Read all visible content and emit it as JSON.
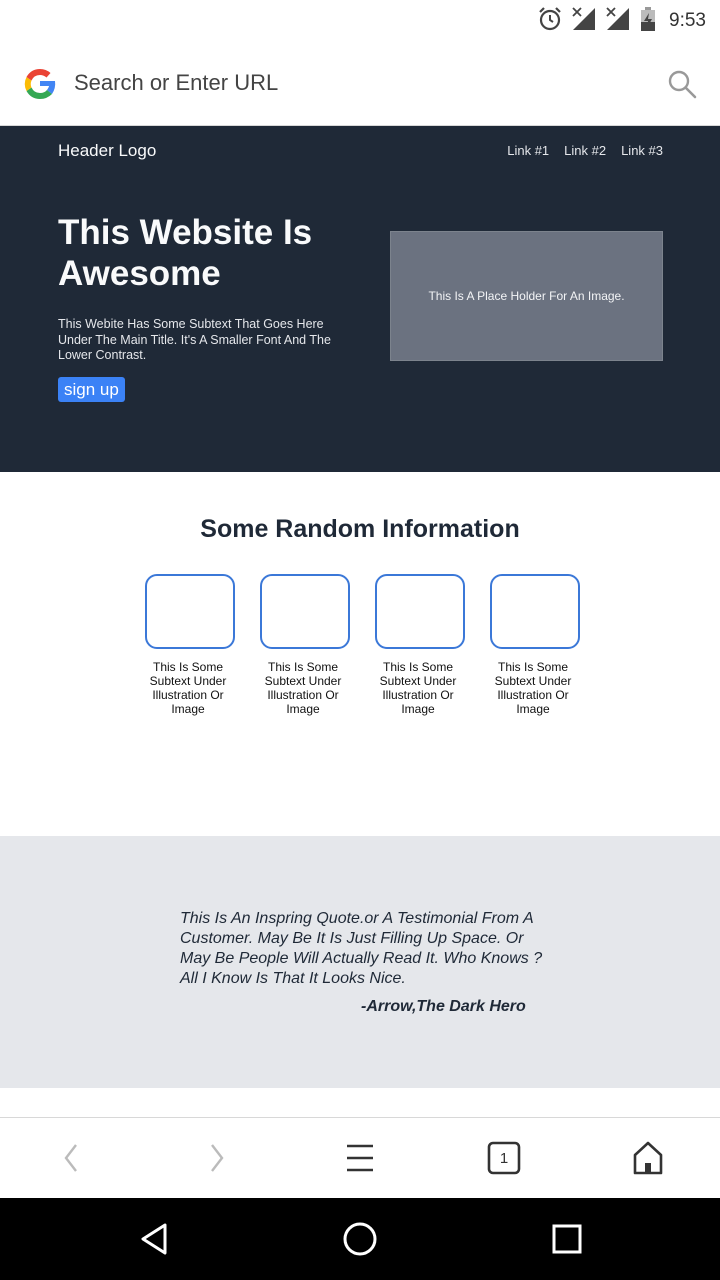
{
  "status_bar": {
    "time": "9:53",
    "icons": [
      "alarm-icon",
      "signal-off-icon",
      "signal-off-icon",
      "battery-charging-icon"
    ]
  },
  "browser": {
    "url_placeholder": "Search or Enter URL",
    "logo": "google-g-logo",
    "search_icon": "search-icon"
  },
  "hero": {
    "logo": "Header Logo",
    "nav": [
      "Link #1",
      "Link #2",
      "Link #3"
    ],
    "title": "This Website Is Awesome",
    "subtitle": "This Webite Has Some Subtext That Goes Here Under The Main Title. It's A Smaller Font And The Lower Contrast.",
    "button": "sign up",
    "image_placeholder": "This Is A Place Holder For An Image."
  },
  "info": {
    "title": "Some Random Information",
    "cards": [
      {
        "text": "This Is Some Subtext Under Illustration Or Image"
      },
      {
        "text": "This Is Some Subtext Under Illustration Or Image"
      },
      {
        "text": "This Is Some Subtext Under Illustration Or Image"
      },
      {
        "text": "This Is Some Subtext Under Illustration Or Image"
      }
    ]
  },
  "quote": {
    "text": "This Is An Inspring Quote.or A Testimonial From A Customer. May Be It Is Just Filling Up Space. Or May Be People Will Actually Read It. Who Knows ? All I Know Is That It Looks Nice.",
    "author": "-Arrow,The Dark Hero"
  },
  "toolbar": {
    "tab_count": "1",
    "items": [
      "back-icon",
      "forward-icon",
      "menu-icon",
      "tabs-icon",
      "home-icon"
    ]
  },
  "android_nav": {
    "items": [
      "back-triangle-icon",
      "home-circle-icon",
      "recents-square-icon"
    ]
  },
  "colors": {
    "hero_bg": "#1f2937",
    "accent": "#3b82f6",
    "card_border": "#3b78d8",
    "quote_bg": "#e5e7eb"
  }
}
